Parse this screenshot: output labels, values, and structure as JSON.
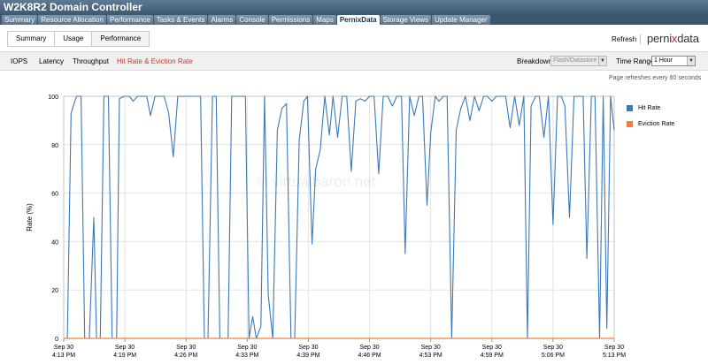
{
  "window": {
    "title": "W2K8R2 Domain Controller"
  },
  "tabs": [
    {
      "label": "Summary",
      "active": false
    },
    {
      "label": "Resource Allocation",
      "active": false
    },
    {
      "label": "Performance",
      "active": false
    },
    {
      "label": "Tasks & Events",
      "active": false
    },
    {
      "label": "Alarms",
      "active": false
    },
    {
      "label": "Console",
      "active": false
    },
    {
      "label": "Permissions",
      "active": false
    },
    {
      "label": "Maps",
      "active": false
    },
    {
      "label": "PernixData",
      "active": true
    },
    {
      "label": "Storage Views",
      "active": false
    },
    {
      "label": "Update Manager",
      "active": false
    }
  ],
  "subtabs": [
    "Summary",
    "Usage",
    "Performance"
  ],
  "header": {
    "refresh": "Refresh",
    "logo_a": "perni",
    "logo_x": "x",
    "logo_b": "data"
  },
  "metrics": [
    "IOPS",
    "Latency",
    "Throughput",
    "Hit Rate & Eviction Rate"
  ],
  "active_metric": "Hit Rate & Eviction Rate",
  "controls": {
    "breakdown_label": "Breakdown:",
    "breakdown_value": "Flash/Datastore",
    "time_range_label": "Time Range:",
    "time_range_value": "1 Hour"
  },
  "refresh_note": "Page refreshes every 60 seconds",
  "watermark": "© virtualbaron.net",
  "colors": {
    "hit": "#3b79b8",
    "evict": "#f07f3c",
    "accent": "#c0392b"
  },
  "chart_data": {
    "type": "line",
    "ylabel": "Rate (%)",
    "ylim": [
      0,
      100
    ],
    "yticks": [
      0,
      20,
      40,
      60,
      80,
      100
    ],
    "xticks": [
      {
        "date": "Sep 30",
        "time": "4:13 PM"
      },
      {
        "date": "Sep 30",
        "time": "4:19 PM"
      },
      {
        "date": "Sep 30",
        "time": "4:26 PM"
      },
      {
        "date": "Sep 30",
        "time": "4:33 PM"
      },
      {
        "date": "Sep 30",
        "time": "4:39 PM"
      },
      {
        "date": "Sep 30",
        "time": "4:46 PM"
      },
      {
        "date": "Sep 30",
        "time": "4:53 PM"
      },
      {
        "date": "Sep 30",
        "time": "4:59 PM"
      },
      {
        "date": "Sep 30",
        "time": "5:06 PM"
      },
      {
        "date": "Sep 30",
        "time": "5:13 PM"
      }
    ],
    "grid": true,
    "legend_position": "right",
    "series": [
      {
        "name": "Hit Rate",
        "color": "#3b79b8",
        "values": [
          [
            0,
            0
          ],
          [
            0.4,
            0
          ],
          [
            0.8,
            93
          ],
          [
            1.4,
            100
          ],
          [
            1.9,
            100
          ],
          [
            2.3,
            0
          ],
          [
            2.8,
            0
          ],
          [
            3.3,
            50
          ],
          [
            3.6,
            0
          ],
          [
            4.0,
            0
          ],
          [
            4.4,
            100
          ],
          [
            4.9,
            100
          ],
          [
            5.3,
            0
          ],
          [
            5.8,
            0
          ],
          [
            6.1,
            99
          ],
          [
            6.6,
            100
          ],
          [
            7.2,
            100
          ],
          [
            7.6,
            98
          ],
          [
            8.1,
            100
          ],
          [
            8.6,
            100
          ],
          [
            9.1,
            100
          ],
          [
            9.5,
            92
          ],
          [
            10.0,
            100
          ],
          [
            10.5,
            100
          ],
          [
            11.0,
            100
          ],
          [
            11.5,
            93
          ],
          [
            12.0,
            75
          ],
          [
            12.5,
            100
          ],
          [
            13.0,
            100
          ],
          [
            13.5,
            100
          ],
          [
            14.0,
            100
          ],
          [
            14.5,
            100
          ],
          [
            15.0,
            100
          ],
          [
            15.4,
            0
          ],
          [
            15.8,
            0
          ],
          [
            16.3,
            100
          ],
          [
            16.7,
            100
          ],
          [
            17.1,
            0
          ],
          [
            17.6,
            0
          ],
          [
            18.0,
            0
          ],
          [
            18.4,
            100
          ],
          [
            18.9,
            100
          ],
          [
            19.4,
            100
          ],
          [
            19.9,
            100
          ],
          [
            20.3,
            0
          ],
          [
            20.7,
            9
          ],
          [
            21.1,
            0
          ],
          [
            21.6,
            5
          ],
          [
            22.0,
            100
          ],
          [
            22.4,
            18
          ],
          [
            22.9,
            0
          ],
          [
            23.4,
            86
          ],
          [
            23.9,
            95
          ],
          [
            24.4,
            97
          ],
          [
            24.9,
            0
          ],
          [
            25.3,
            0
          ],
          [
            25.8,
            82
          ],
          [
            26.3,
            98
          ],
          [
            26.7,
            100
          ],
          [
            27.2,
            39
          ],
          [
            27.6,
            70
          ],
          [
            28.1,
            78
          ],
          [
            28.6,
            100
          ],
          [
            29.1,
            84
          ],
          [
            29.5,
            100
          ],
          [
            30.0,
            83
          ],
          [
            30.5,
            100
          ],
          [
            31.0,
            100
          ],
          [
            31.5,
            69
          ],
          [
            32.0,
            98
          ],
          [
            32.5,
            99
          ],
          [
            33.0,
            98
          ],
          [
            33.5,
            100
          ],
          [
            34.0,
            100
          ],
          [
            34.5,
            68
          ],
          [
            35.0,
            100
          ],
          [
            35.5,
            100
          ],
          [
            36.0,
            96
          ],
          [
            36.5,
            100
          ],
          [
            37.0,
            100
          ],
          [
            37.4,
            35
          ],
          [
            37.9,
            100
          ],
          [
            38.4,
            92
          ],
          [
            38.9,
            100
          ],
          [
            39.3,
            100
          ],
          [
            39.8,
            55
          ],
          [
            40.2,
            85
          ],
          [
            40.7,
            100
          ],
          [
            41.1,
            98
          ],
          [
            41.6,
            100
          ],
          [
            42.0,
            100
          ],
          [
            42.5,
            0
          ],
          [
            43.0,
            86
          ],
          [
            43.5,
            95
          ],
          [
            44.0,
            100
          ],
          [
            44.5,
            90
          ],
          [
            45.0,
            100
          ],
          [
            45.5,
            94
          ],
          [
            46.0,
            100
          ],
          [
            46.4,
            100
          ],
          [
            46.9,
            98
          ],
          [
            47.4,
            100
          ],
          [
            47.9,
            100
          ],
          [
            48.4,
            100
          ],
          [
            48.9,
            87
          ],
          [
            49.4,
            100
          ],
          [
            49.9,
            88
          ],
          [
            50.4,
            100
          ],
          [
            50.8,
            0
          ],
          [
            51.2,
            96
          ],
          [
            51.7,
            100
          ],
          [
            52.1,
            100
          ],
          [
            52.6,
            83
          ],
          [
            53.1,
            100
          ],
          [
            53.6,
            47
          ],
          [
            54.1,
            100
          ],
          [
            54.5,
            100
          ],
          [
            54.9,
            96
          ],
          [
            55.4,
            50
          ],
          [
            55.9,
            100
          ],
          [
            56.4,
            100
          ],
          [
            56.9,
            100
          ],
          [
            57.3,
            33
          ],
          [
            57.8,
            100
          ],
          [
            58.2,
            100
          ],
          [
            58.7,
            0
          ],
          [
            59.1,
            100
          ],
          [
            59.5,
            4
          ],
          [
            59.9,
            100
          ],
          [
            60.3,
            86
          ]
        ]
      },
      {
        "name": "Eviction Rate",
        "color": "#f07f3c",
        "values": [
          [
            0,
            0
          ],
          [
            60.3,
            0
          ]
        ]
      }
    ]
  }
}
